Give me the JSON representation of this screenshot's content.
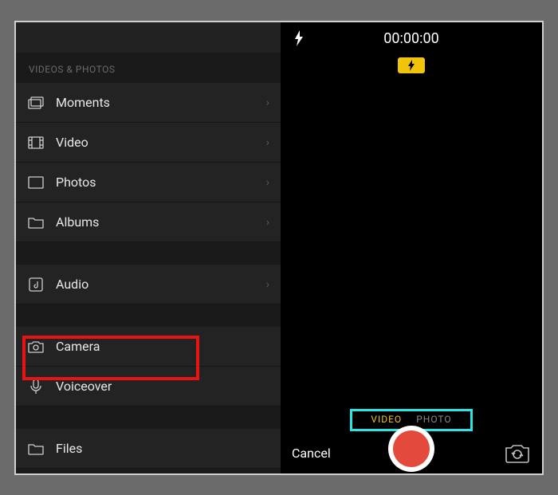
{
  "sidebar": {
    "section_header": "VIDEOS & PHOTOS",
    "items": {
      "moments": "Moments",
      "video": "Video",
      "photos": "Photos",
      "albums": "Albums",
      "audio": "Audio",
      "camera": "Camera",
      "voiceover": "Voiceover",
      "files": "Files"
    }
  },
  "camera": {
    "timer": "00:00:00",
    "modes": {
      "video": "VIDEO",
      "photo": "PHOTO"
    },
    "cancel": "Cancel"
  },
  "highlights": {
    "red_target": "camera",
    "cyan_target": "mode-switch"
  }
}
